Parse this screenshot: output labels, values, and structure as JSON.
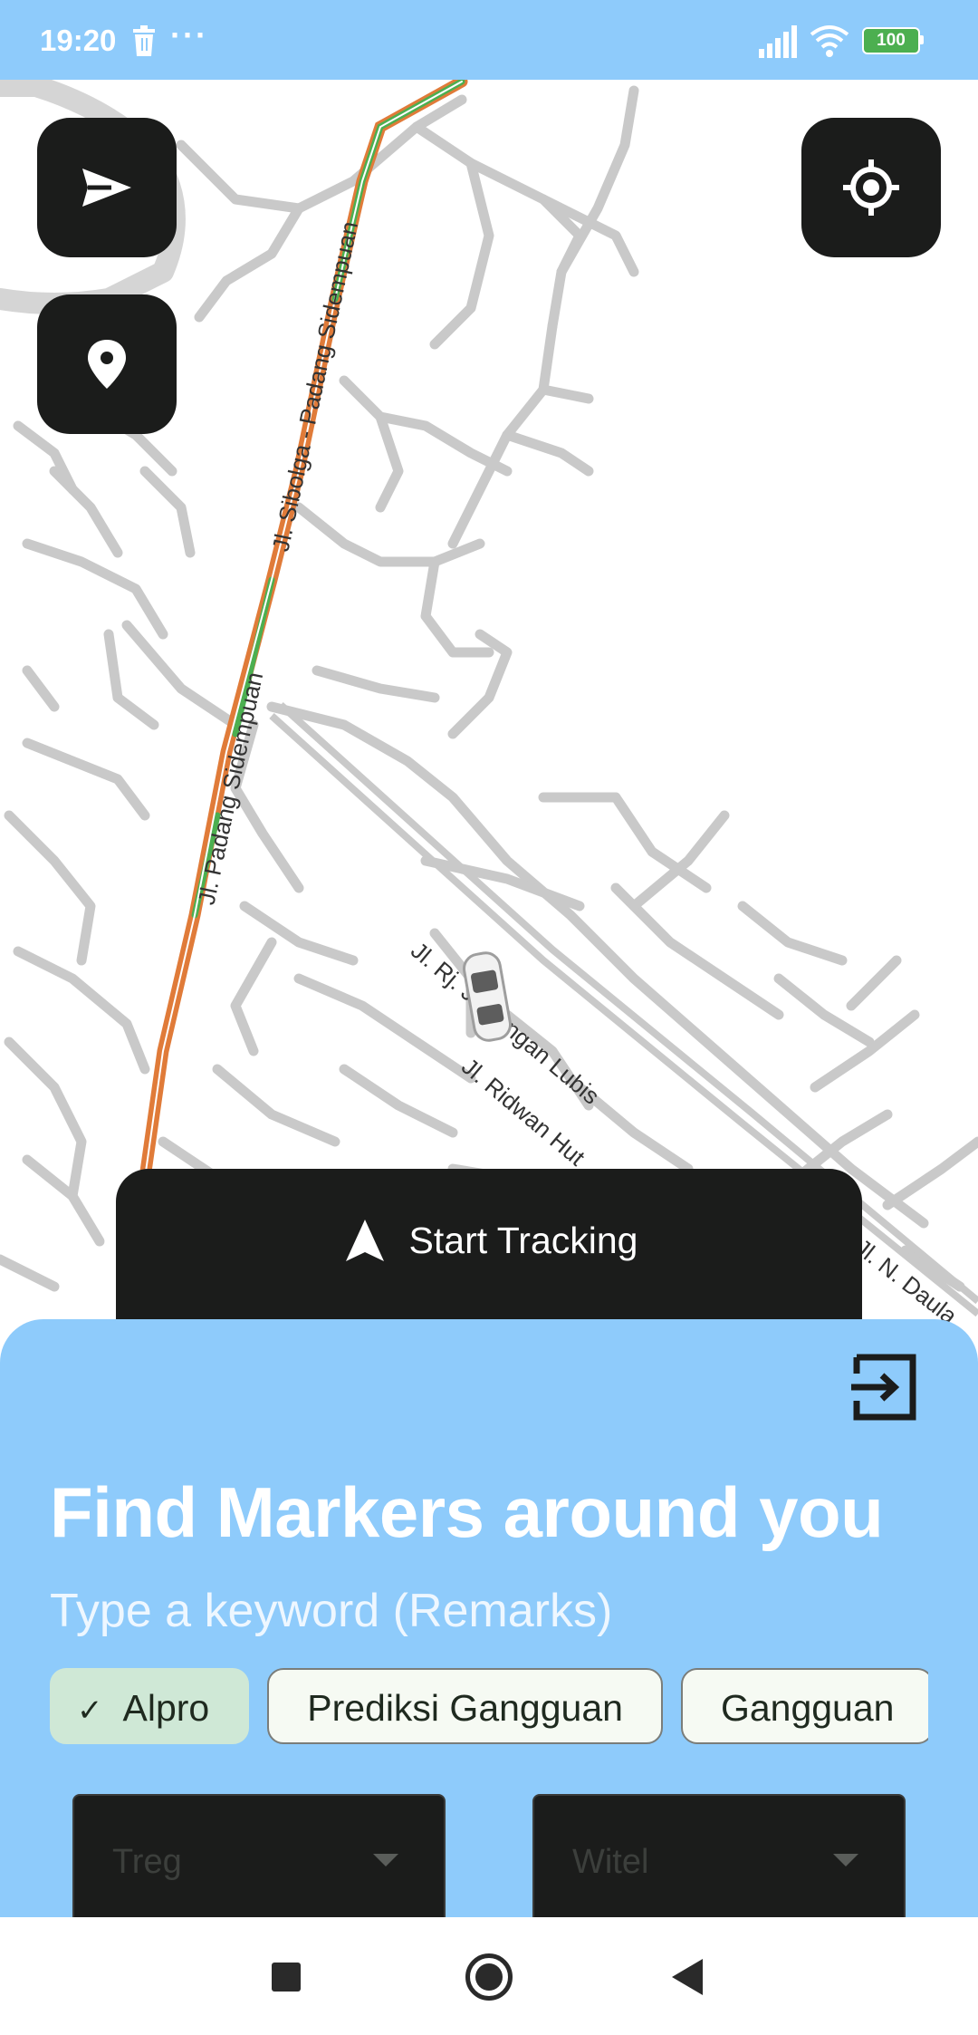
{
  "status_bar": {
    "time": "19:20",
    "battery": "100",
    "icons": [
      "trash-icon",
      "more-dots-icon",
      "signal-icon",
      "wifi-icon",
      "battery-icon"
    ]
  },
  "map": {
    "road_labels": {
      "road_1": "Jl. Sibolga - Padang Sidempuan",
      "road_2": "Jl. Padang Sidempuan",
      "road_3": "Jl. Rj. Junjungan Lubis",
      "road_4": "Jl. Ridwan Hut",
      "road_5": "Jl. N. Daula"
    }
  },
  "fabs": {
    "navigate_icon": "send-icon",
    "marker_icon": "location-pin-icon",
    "locate_icon": "my-location-icon"
  },
  "tracking": {
    "label": "Start Tracking",
    "icon": "navigation-arrow-icon"
  },
  "sheet": {
    "title": "Find Markers around you",
    "search_placeholder": "Type a keyword (Remarks)",
    "exit_icon": "exit-icon",
    "chips": [
      {
        "label": "Alpro",
        "selected": true
      },
      {
        "label": "Prediksi Gangguan",
        "selected": false
      },
      {
        "label": "Gangguan",
        "selected": false
      }
    ],
    "dropdowns": {
      "treg_label": "Treg",
      "witel_label": "Witel"
    }
  },
  "colors": {
    "accent": "#8ecbfb",
    "dark_button": "#1b1c1b",
    "chip_selected": "#cfe8d6",
    "road_main_orange": "#e07b39",
    "road_main_green": "#4caf50",
    "road_minor": "#c9c9c9"
  }
}
